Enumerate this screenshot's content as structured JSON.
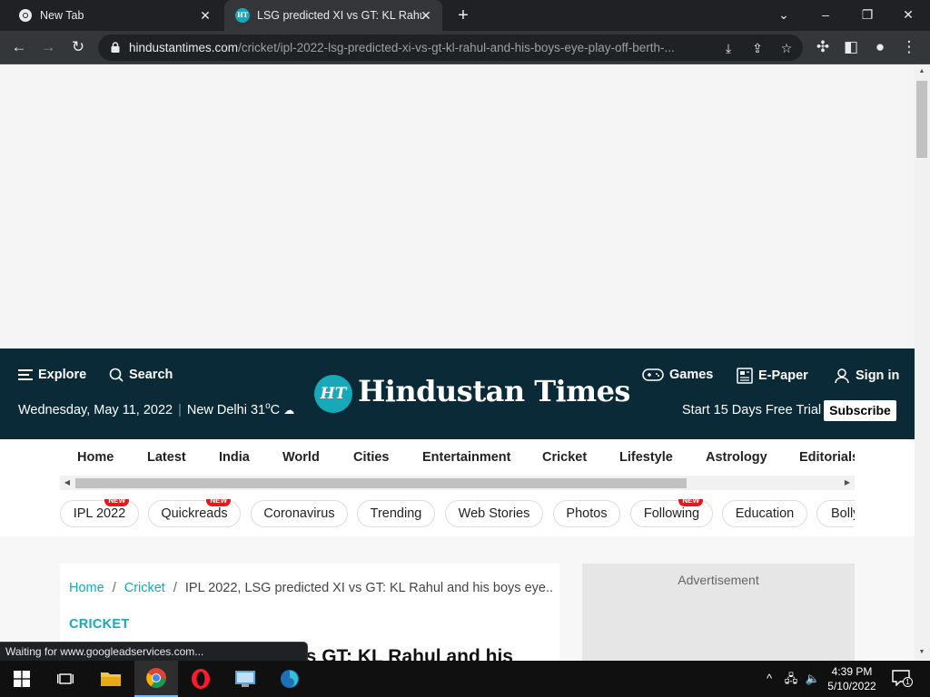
{
  "browser": {
    "tabs": [
      {
        "title": "New Tab"
      },
      {
        "title": "LSG predicted XI vs GT: KL Rahul"
      }
    ],
    "url_host": "hindustantimes.com",
    "url_path": "/cricket/ipl-2022-lsg-predicted-xi-vs-gt-kl-rahul-and-his-boys-eye-play-off-berth-...",
    "status_text": "Waiting for www.googleadservices.com..."
  },
  "header": {
    "explore_label": "Explore",
    "search_label": "Search",
    "logo_badge": "HT",
    "logo_text": "Hindustan Times",
    "games_label": "Games",
    "epaper_label": "E-Paper",
    "signin_label": "Sign in",
    "date": "Wednesday, May 11, 2022",
    "city_weather": "New Delhi 31",
    "temp_unit": "o",
    "temp_c": "C",
    "trial_text": "Start 15 Days Free Trial",
    "subscribe_label": "Subscribe"
  },
  "nav": {
    "items": [
      "Home",
      "Latest",
      "India",
      "World",
      "Cities",
      "Entertainment",
      "Cricket",
      "Lifestyle",
      "Astrology",
      "Editorials"
    ]
  },
  "chips": {
    "new_badge": "NEW",
    "items": [
      "IPL 2022",
      "Quickreads",
      "Coronavirus",
      "Trending",
      "Web Stories",
      "Photos",
      "Following",
      "Education",
      "Bolly"
    ]
  },
  "article": {
    "breadcrumb_home": "Home",
    "breadcrumb_section": "Cricket",
    "breadcrumb_current": "IPL 2022, LSG predicted XI vs GT: KL Rahul and his boys eye...",
    "section_tag": "CRICKET",
    "headline_visible": "vs GT: KL Rahul and his"
  },
  "sidebar": {
    "ad_label": "Advertisement"
  },
  "taskbar": {
    "time": "4:39 PM",
    "date": "5/10/2022",
    "notification_count": "1"
  },
  "colors": {
    "header_bg": "#0b2a38",
    "accent_teal": "#17a9b8",
    "new_badge_red": "#e21b22"
  }
}
